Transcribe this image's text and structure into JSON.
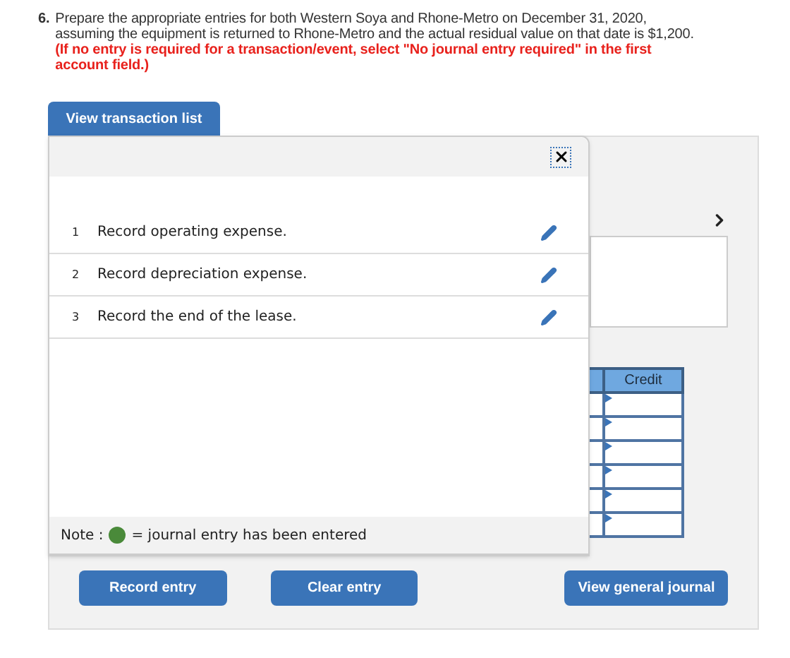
{
  "question": {
    "number": "6.",
    "text": "Prepare the appropriate entries for both Western Soya and Rhone-Metro on December 31, 2020, assuming the equipment is returned to Rhone-Metro and the actual residual value on that date is $1,200.",
    "instruction": "(If no entry is required for a transaction/event, select \"No journal entry required\" in the first account field.)"
  },
  "tab_button": "View transaction list",
  "transactions": [
    {
      "number": "1",
      "label": "Record operating expense."
    },
    {
      "number": "2",
      "label": "Record depreciation expense."
    },
    {
      "number": "3",
      "label": "Record the end of the lease."
    }
  ],
  "note": {
    "prefix": "Note :",
    "suffix": "= journal entry has been entered",
    "color": "#4a8a3a"
  },
  "journal": {
    "columns": [
      "Credit"
    ]
  },
  "buttons": [
    "Record entry",
    "Clear entry",
    "View general journal"
  ]
}
